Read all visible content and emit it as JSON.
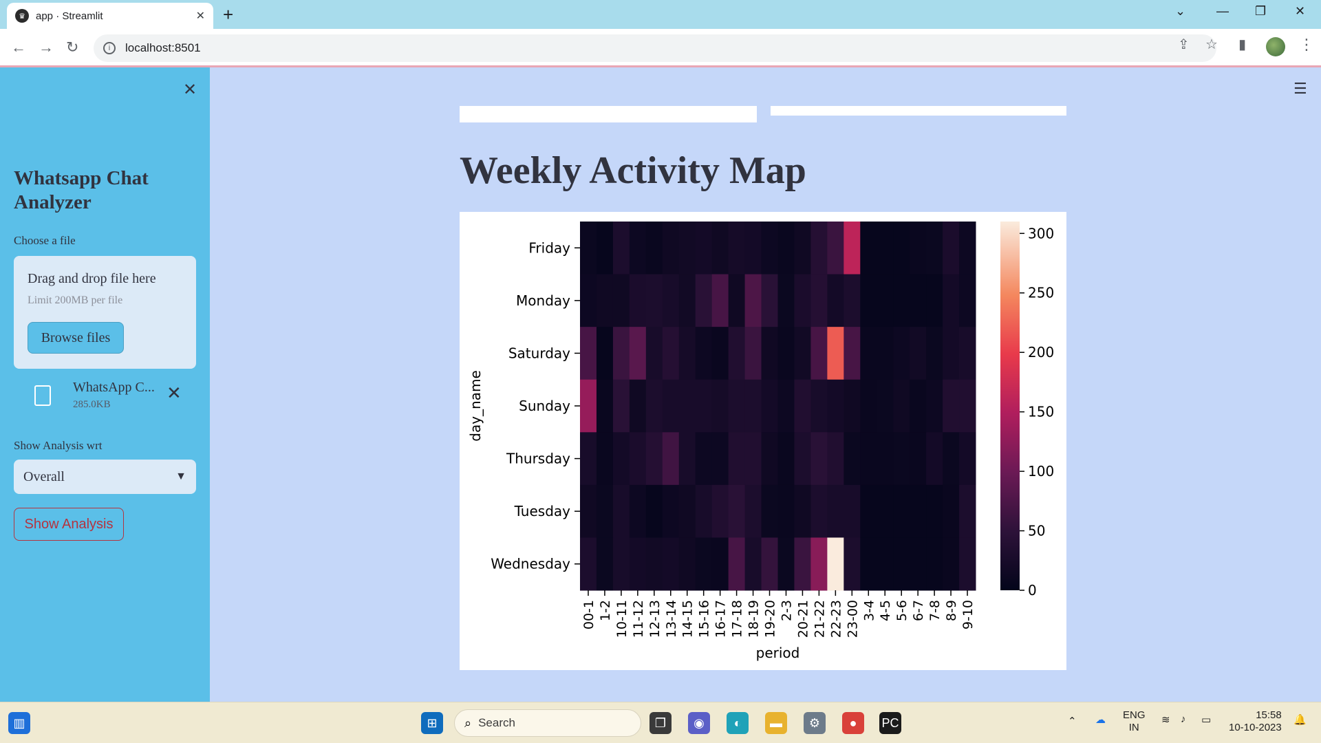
{
  "browser": {
    "tab_title": "app · Streamlit",
    "url": "localhost:8501",
    "favicon": "streamlit-crown-icon"
  },
  "sidebar": {
    "title": "Whatsapp Chat Analyzer",
    "file_label": "Choose a file",
    "dropzone_title": "Drag and drop file here",
    "dropzone_limit": "Limit 200MB per file",
    "browse_label": "Browse files",
    "file_name": "WhatsApp C...",
    "file_size": "285.0KB",
    "analysis_label": "Show Analysis wrt",
    "analysis_value": "Overall",
    "show_button": "Show Analysis"
  },
  "main": {
    "heading": "Weekly Activity Map"
  },
  "chart_data": {
    "type": "heatmap",
    "title": "",
    "xlabel": "period",
    "ylabel": "day_name",
    "x": [
      "00-1",
      "1-2",
      "10-11",
      "11-12",
      "12-13",
      "13-14",
      "14-15",
      "15-16",
      "16-17",
      "17-18",
      "18-19",
      "19-20",
      "2-3",
      "20-21",
      "21-22",
      "22-23",
      "23-00",
      "3-4",
      "4-5",
      "5-6",
      "6-7",
      "7-8",
      "8-9",
      "9-10"
    ],
    "y": [
      "Friday",
      "Monday",
      "Saturday",
      "Sunday",
      "Thursday",
      "Tuesday",
      "Wednesday"
    ],
    "values": [
      [
        10,
        5,
        30,
        12,
        8,
        15,
        18,
        20,
        15,
        22,
        20,
        12,
        8,
        15,
        40,
        60,
        160,
        5,
        5,
        5,
        8,
        10,
        28,
        12
      ],
      [
        12,
        15,
        15,
        28,
        30,
        25,
        18,
        45,
        70,
        15,
        75,
        45,
        10,
        28,
        40,
        20,
        30,
        5,
        5,
        5,
        5,
        5,
        20,
        12
      ],
      [
        70,
        5,
        60,
        85,
        25,
        40,
        22,
        12,
        8,
        35,
        60,
        15,
        8,
        18,
        70,
        220,
        70,
        8,
        8,
        12,
        18,
        10,
        20,
        25
      ],
      [
        130,
        8,
        45,
        15,
        30,
        25,
        25,
        25,
        22,
        30,
        30,
        20,
        12,
        35,
        25,
        20,
        15,
        8,
        10,
        15,
        8,
        12,
        35,
        35
      ],
      [
        25,
        8,
        20,
        28,
        40,
        65,
        25,
        12,
        12,
        35,
        35,
        15,
        8,
        30,
        45,
        35,
        10,
        8,
        8,
        10,
        8,
        20,
        10,
        20
      ],
      [
        15,
        10,
        25,
        12,
        5,
        12,
        15,
        25,
        35,
        45,
        30,
        10,
        8,
        15,
        30,
        25,
        25,
        5,
        5,
        5,
        5,
        5,
        8,
        30
      ],
      [
        30,
        10,
        25,
        20,
        18,
        20,
        15,
        10,
        8,
        70,
        25,
        55,
        10,
        60,
        120,
        310,
        30,
        5,
        5,
        5,
        5,
        5,
        8,
        30
      ]
    ],
    "colorbar_ticks": [
      0,
      50,
      100,
      150,
      200,
      250,
      300
    ],
    "vmin": 0,
    "vmax": 310,
    "colormap": "rocket",
    "legend": "colorbar-right"
  },
  "taskbar": {
    "search_placeholder": "Search",
    "lang_top": "ENG",
    "lang_bottom": "IN",
    "time": "15:58",
    "date": "10-10-2023"
  }
}
